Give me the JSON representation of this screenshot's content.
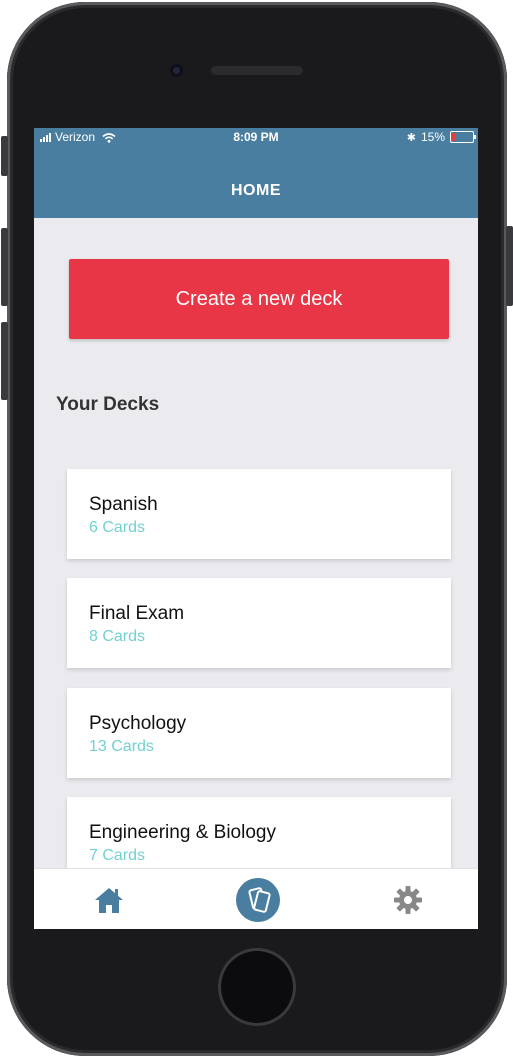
{
  "status_bar": {
    "carrier": "Verizon",
    "time": "8:09 PM",
    "battery": "15%",
    "battery_level": 0.15,
    "icons": [
      "signal-icon",
      "wifi-icon",
      "bluetooth-icon",
      "battery-icon"
    ]
  },
  "header": {
    "title": "HOME"
  },
  "create_button": {
    "label": "Create a new deck"
  },
  "decks_section": {
    "title": "Your Decks",
    "items": [
      {
        "name": "Spanish",
        "count": "6 Cards"
      },
      {
        "name": "Final Exam",
        "count": "8 Cards"
      },
      {
        "name": "Psychology",
        "count": "13 Cards"
      },
      {
        "name": "Engineering & Biology",
        "count": "7 Cards"
      }
    ]
  },
  "tab_bar": {
    "tabs": [
      {
        "icon": "home-icon",
        "active": true
      },
      {
        "icon": "cards-icon",
        "active": false
      },
      {
        "icon": "gear-icon",
        "active": false
      }
    ]
  },
  "colors": {
    "header": "#4a7ea1",
    "accent_red": "#e83646",
    "card_count": "#72d0d2",
    "background": "#ebeaef",
    "tab_icon_active": "#4a7ea1",
    "tab_icon_inactive": "#888888"
  }
}
